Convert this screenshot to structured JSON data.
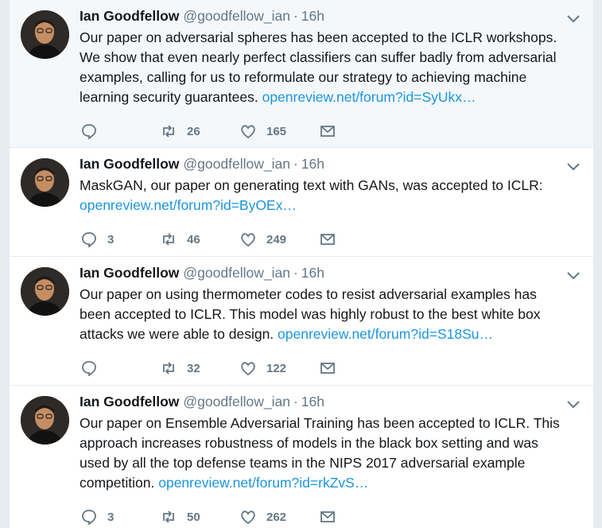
{
  "tweets": [
    {
      "name": "Ian Goodfellow",
      "handle": "@goodfellow_ian",
      "dot": "·",
      "time": "16h",
      "text": "Our paper on adversarial spheres has been accepted to the ICLR workshops. We show that even nearly perfect classifiers can suffer badly from adversarial examples, calling for us to reformulate our strategy to achieving machine learning security guarantees.",
      "link": "openreview.net/forum?id=SyUkx…",
      "replies": "",
      "retweets": "26",
      "likes": "165"
    },
    {
      "name": "Ian Goodfellow",
      "handle": "@goodfellow_ian",
      "dot": "·",
      "time": "16h",
      "text": "MaskGAN, our paper on generating text with GANs, was accepted to ICLR:",
      "link": "openreview.net/forum?id=ByOEx…",
      "replies": "3",
      "retweets": "46",
      "likes": "249"
    },
    {
      "name": "Ian Goodfellow",
      "handle": "@goodfellow_ian",
      "dot": "·",
      "time": "16h",
      "text": "Our paper on using thermometer codes to resist adversarial examples has been accepted to ICLR. This model was highly robust to the best white box attacks we were able to design.",
      "link": "openreview.net/forum?id=S18Su…",
      "replies": "",
      "retweets": "32",
      "likes": "122"
    },
    {
      "name": "Ian Goodfellow",
      "handle": "@goodfellow_ian",
      "dot": "·",
      "time": "16h",
      "text": "Our paper on Ensemble Adversarial Training has been accepted to ICLR. This approach increases robustness of models in the black box setting and was used by all the top defense teams in the NIPS 2017 adversarial example competition.",
      "link": "openreview.net/forum?id=rkZvS…",
      "replies": "3",
      "retweets": "50",
      "likes": "262"
    }
  ],
  "colors": {
    "text": "#14171a",
    "secondary": "#657786",
    "link": "#1b95e0",
    "highlight": "#f5f8fa",
    "border": "#e6ecf0"
  },
  "icons": [
    "avatar-photo",
    "chevron-down-icon",
    "reply-icon",
    "retweet-icon",
    "like-icon",
    "message-icon"
  ]
}
